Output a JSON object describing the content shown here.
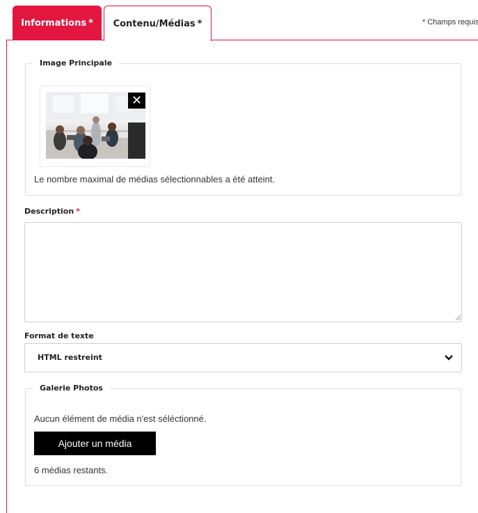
{
  "tabs": [
    {
      "label": "Informations",
      "required": "*",
      "active": true
    },
    {
      "label": "Contenu/Médias",
      "required": "*",
      "active": false
    }
  ],
  "required_note": "* Champs requis",
  "colors": {
    "accent": "#e3163f",
    "border": "#dcdcdc",
    "button": "#000000"
  },
  "image_principale": {
    "legend": "Image Principale",
    "remove_icon": "close-icon",
    "message": "Le nombre maximal de médias sélectionnables a été atteint."
  },
  "description": {
    "label": "Description",
    "required": "*",
    "value": ""
  },
  "format": {
    "label": "Format de texte",
    "selected": "HTML restreint",
    "icon": "chevron-down-icon"
  },
  "galerie": {
    "legend": "Galerie Photos",
    "empty_message": "Aucun élément de média n'est séléctionné.",
    "add_button": "Ajouter un média",
    "remaining": "6 médias restants."
  }
}
